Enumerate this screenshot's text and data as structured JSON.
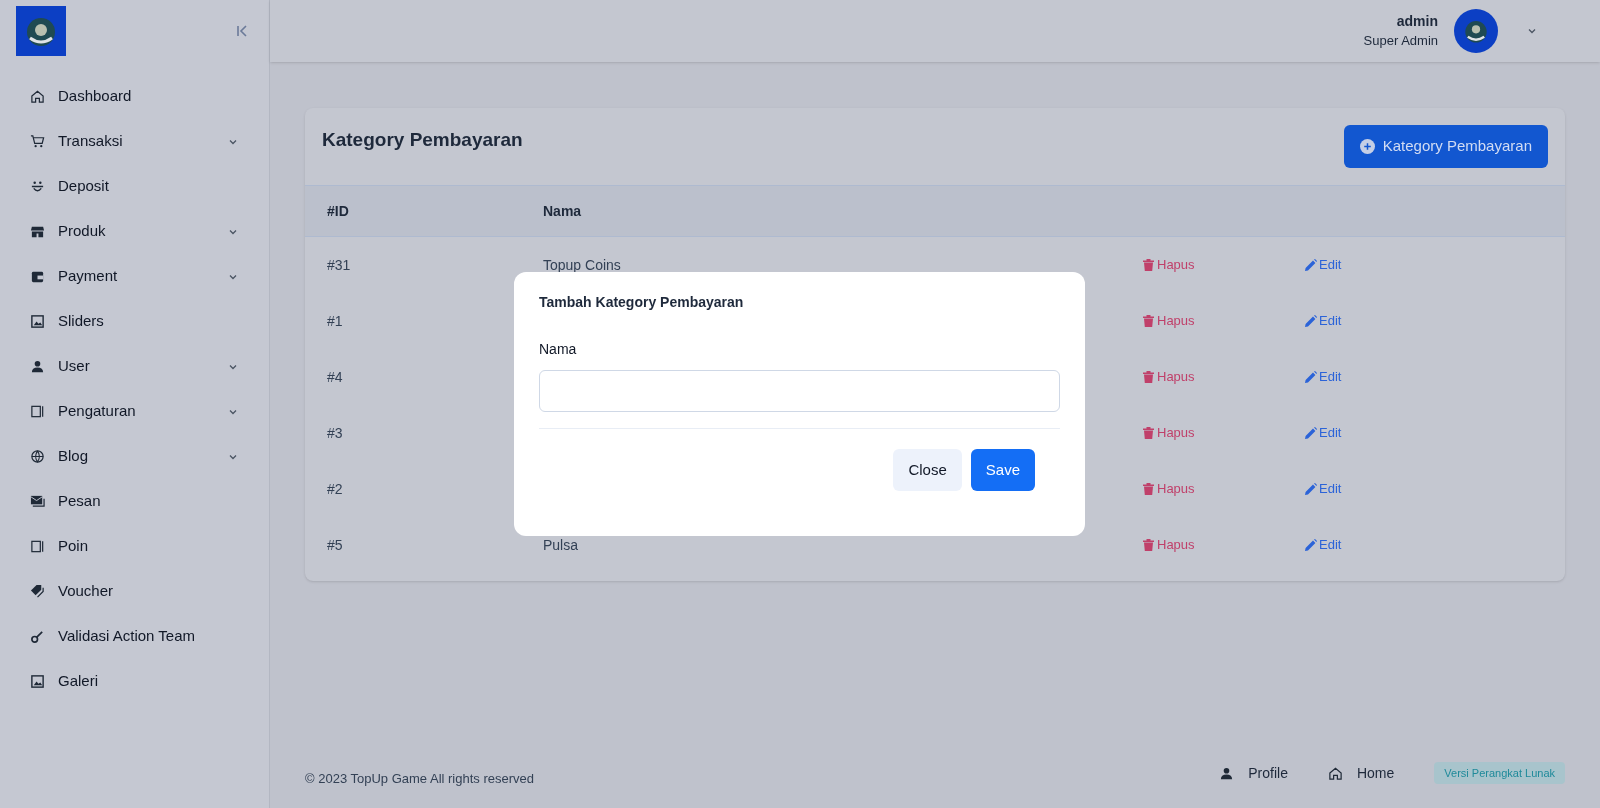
{
  "sidebar": {
    "items": [
      {
        "label": "Dashboard",
        "has_submenu": false
      },
      {
        "label": "Transaksi",
        "has_submenu": true
      },
      {
        "label": "Deposit",
        "has_submenu": false
      },
      {
        "label": "Produk",
        "has_submenu": true
      },
      {
        "label": "Payment",
        "has_submenu": true
      },
      {
        "label": "Sliders",
        "has_submenu": false
      },
      {
        "label": "User",
        "has_submenu": true
      },
      {
        "label": "Pengaturan",
        "has_submenu": true
      },
      {
        "label": "Blog",
        "has_submenu": true
      },
      {
        "label": "Pesan",
        "has_submenu": false
      },
      {
        "label": "Poin",
        "has_submenu": false
      },
      {
        "label": "Voucher",
        "has_submenu": false
      },
      {
        "label": "Validasi Action Team",
        "has_submenu": false
      },
      {
        "label": "Galeri",
        "has_submenu": false
      }
    ]
  },
  "header": {
    "user_name": "admin",
    "user_role": "Super Admin"
  },
  "card": {
    "title": "Kategory Pembayaran",
    "add_button": "Kategory Pembayaran",
    "table": {
      "columns": [
        "#ID",
        "Nama"
      ],
      "rows": [
        {
          "id": "#31",
          "name": "Topup Coins",
          "delete": "Hapus",
          "edit": "Edit"
        },
        {
          "id": "#1",
          "delete": "Hapus",
          "edit": "Edit"
        },
        {
          "id": "#4",
          "delete": "Hapus",
          "edit": "Edit"
        },
        {
          "id": "#3",
          "delete": "Hapus",
          "edit": "Edit"
        },
        {
          "id": "#2",
          "delete": "Hapus",
          "edit": "Edit"
        },
        {
          "id": "#5",
          "name": "Pulsa",
          "delete": "Hapus",
          "edit": "Edit"
        }
      ]
    }
  },
  "modal": {
    "title": "Tambah Kategory Pembayaran",
    "field_label": "Nama",
    "buttons": [
      {
        "label": "Close",
        "kind": "secondary"
      },
      {
        "label": "Save",
        "kind": "primary"
      }
    ]
  },
  "footer": {
    "copyright": "© 2023 TopUp Game All rights reserved",
    "links": [
      "Profile",
      "Home"
    ],
    "version_badge": "Versi Perangkat Lunak"
  }
}
